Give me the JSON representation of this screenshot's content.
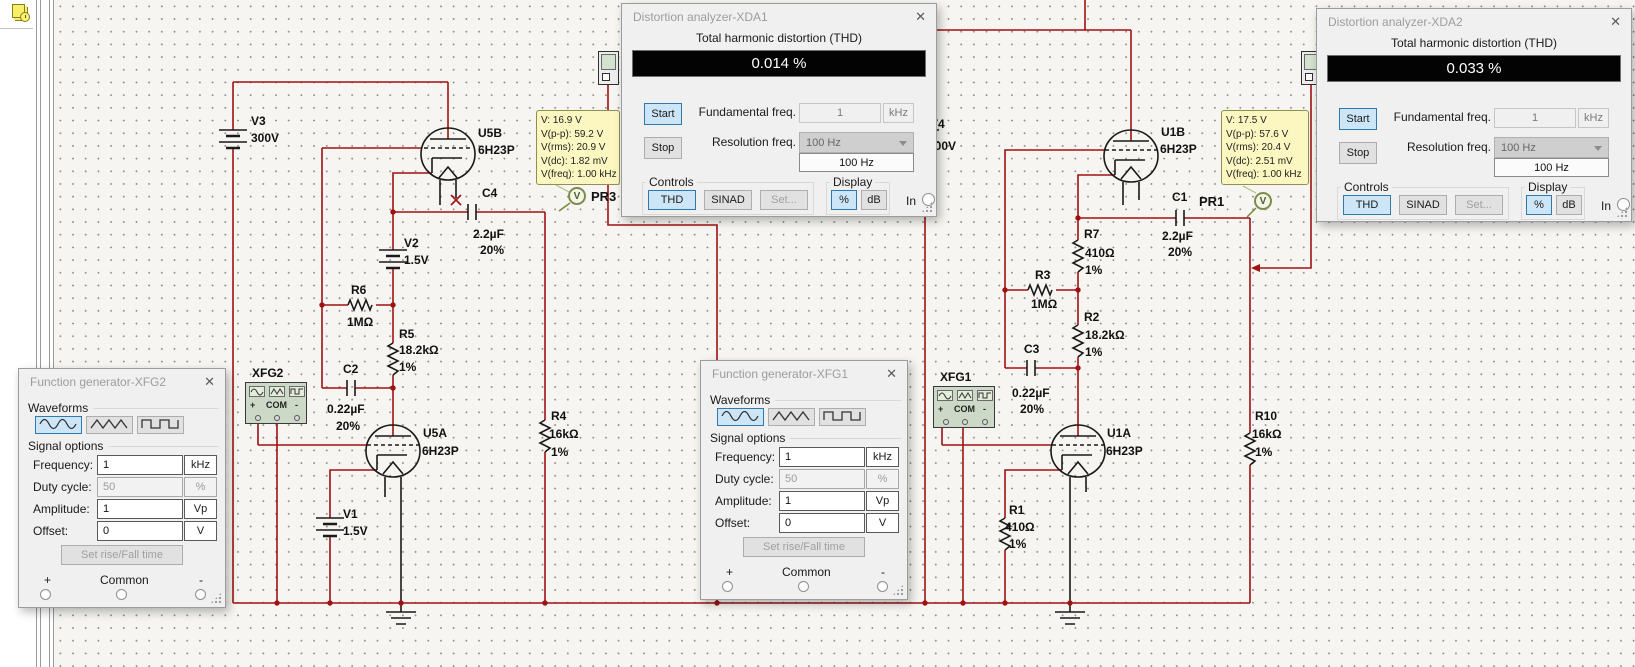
{
  "xda1": {
    "title": "Distortion analyzer-XDA1",
    "subtitle": "Total harmonic distortion (THD)",
    "value": "0.014 %",
    "start": "Start",
    "stop": "Stop",
    "fundamental_label": "Fundamental freq.",
    "fundamental_value": "1",
    "fundamental_unit": "kHz",
    "resolution_label": "Resolution freq.",
    "resolution_dropdown": "100 Hz",
    "resolution_value": "100 Hz",
    "controls_label": "Controls",
    "thd": "THD",
    "sinad": "SINAD",
    "set": "Set...",
    "display_label": "Display",
    "percent": "%",
    "db": "dB",
    "in_label": "In"
  },
  "xda2": {
    "title": "Distortion analyzer-XDA2",
    "subtitle": "Total harmonic distortion (THD)",
    "value": "0.033 %",
    "start": "Start",
    "stop": "Stop",
    "fundamental_label": "Fundamental freq.",
    "fundamental_value": "1",
    "fundamental_unit": "kHz",
    "resolution_label": "Resolution freq.",
    "resolution_dropdown": "100 Hz",
    "resolution_value": "100 Hz",
    "controls_label": "Controls",
    "thd": "THD",
    "sinad": "SINAD",
    "set": "Set...",
    "display_label": "Display",
    "percent": "%",
    "db": "dB",
    "in_label": "In"
  },
  "xfg1": {
    "title": "Function generator-XFG1",
    "waveforms_label": "Waveforms",
    "signal_options_label": "Signal options",
    "frequency_label": "Frequency:",
    "frequency_value": "1",
    "frequency_unit": "kHz",
    "duty_label": "Duty cycle:",
    "duty_value": "50",
    "duty_unit": "%",
    "amplitude_label": "Amplitude:",
    "amplitude_value": "1",
    "amplitude_unit": "Vp",
    "offset_label": "Offset:",
    "offset_value": "0",
    "offset_unit": "V",
    "set_rise_fall": "Set rise/Fall time",
    "plus": "+",
    "common": "Common",
    "minus": "-"
  },
  "xfg2": {
    "title": "Function generator-XFG2",
    "waveforms_label": "Waveforms",
    "signal_options_label": "Signal options",
    "frequency_label": "Frequency:",
    "frequency_value": "1",
    "frequency_unit": "kHz",
    "duty_label": "Duty cycle:",
    "duty_value": "50",
    "duty_unit": "%",
    "amplitude_label": "Amplitude:",
    "amplitude_value": "1",
    "amplitude_unit": "Vp",
    "offset_label": "Offset:",
    "offset_value": "0",
    "offset_unit": "V",
    "set_rise_fall": "Set rise/Fall time",
    "plus": "+",
    "common": "Common",
    "minus": "-"
  },
  "probes": {
    "pr3": {
      "label": "PR3",
      "glyph": "V",
      "lines": [
        "V: 16.9 V",
        "V(p-p): 59.2 V",
        "V(rms): 20.9 V",
        "V(dc): 1.82 mV",
        "V(freq): 1.00 kHz"
      ]
    },
    "pr1": {
      "label": "PR1",
      "glyph": "V",
      "lines": [
        "V: 17.5 V",
        "V(p-p): 57.6 V",
        "V(rms): 20.4 V",
        "V(dc): 2.51 mV",
        "V(freq): 1.00 kHz"
      ]
    }
  },
  "schematic": {
    "v3_ref": "V3",
    "v3_val": "300V",
    "v2_ref": "V2",
    "v2_val": "1.5V",
    "v1_ref": "V1",
    "v1_val": "1.5V",
    "v4_ref": "V4",
    "v4_val": "300V",
    "u5b_ref": "U5B",
    "u5b_val": "6H23P",
    "u5a_ref": "U5A",
    "u5a_val": "6H23P",
    "u1b_ref": "U1B",
    "u1b_val": "6H23P",
    "u1a_ref": "U1A",
    "u1a_val": "6H23P",
    "c4_ref": "C4",
    "c4_val": "2.2µF",
    "c4_tol": "20%",
    "c2_ref": "C2",
    "c2_val": "0.22µF",
    "c2_tol": "20%",
    "c1_ref": "C1",
    "c1_val": "2.2µF",
    "c1_tol": "20%",
    "c3_ref": "C3",
    "c3_val": "0.22µF",
    "c3_tol": "20%",
    "r6_ref": "R6",
    "r6_val": "1MΩ",
    "r5_ref": "R5",
    "r5_val": "18.2kΩ",
    "r5_tol": "1%",
    "r4_ref": "R4",
    "r4_val": "16kΩ",
    "r4_tol": "1%",
    "r7_ref": "R7",
    "r7_val": "410Ω",
    "r7_tol": "1%",
    "r3_ref": "R3",
    "r3_val": "1MΩ",
    "r2_ref": "R2",
    "r2_val": "18.2kΩ",
    "r2_tol": "1%",
    "r1_ref": "R1",
    "r1_val": "410Ω",
    "r1_tol": "1%",
    "r10_ref": "R10",
    "r10_val": "16kΩ",
    "r10_tol": "1%",
    "xfg1_ref": "XFG1",
    "xfg2_ref": "XFG2",
    "com": "COM",
    "plus": "+",
    "minus": "-"
  },
  "icons": {
    "close": "✕",
    "canvas_tool": "in-use-list-icon",
    "xda_instrument": "distortion-analyzer-icon",
    "xfg_instrument": "function-generator-icon",
    "probe": "voltage-probe-icon",
    "sine": "sine-wave-icon",
    "triangle": "triangle-wave-icon",
    "square": "square-wave-icon"
  },
  "colors": {
    "wire": "#a01212",
    "canvas": "#f6f5f1",
    "selected_fill": "#cde6f7",
    "probe_box": "#fcf7c0"
  }
}
